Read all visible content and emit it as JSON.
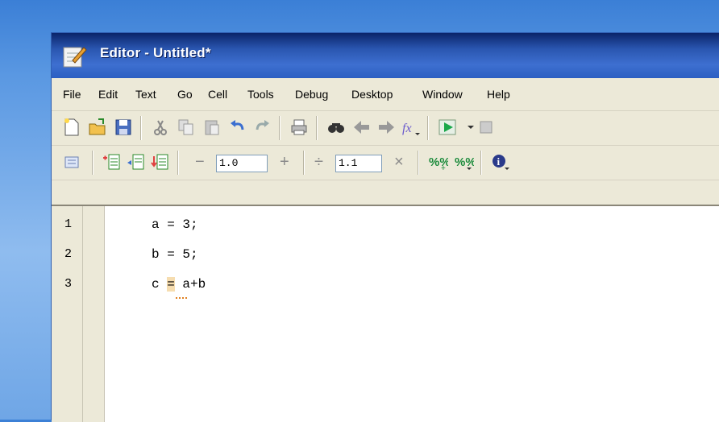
{
  "window": {
    "title": "Editor - Untitled*"
  },
  "menu": [
    "File",
    "Edit",
    "Text",
    "Go",
    "Cell",
    "Tools",
    "Debug",
    "Desktop",
    "Window",
    "Help"
  ],
  "toolbar_cell": {
    "decrement_label": "−",
    "decrement_value": "1.0",
    "increment_label": "+",
    "divide_label": "÷",
    "divide_value": "1.1",
    "multiply_label": "×"
  },
  "editor": {
    "lines": [
      {
        "number": "1",
        "code": "a = 3;"
      },
      {
        "number": "2",
        "code": "b = 5;"
      },
      {
        "number": "3",
        "code_before": "c ",
        "code_highlight": "=",
        "code_after": " a+b"
      }
    ]
  },
  "colors": {
    "titlebar": "#2a56b0",
    "chrome": "#ece9d8",
    "highlight": "#f6ddb0",
    "warning_underline": "#e08020"
  }
}
